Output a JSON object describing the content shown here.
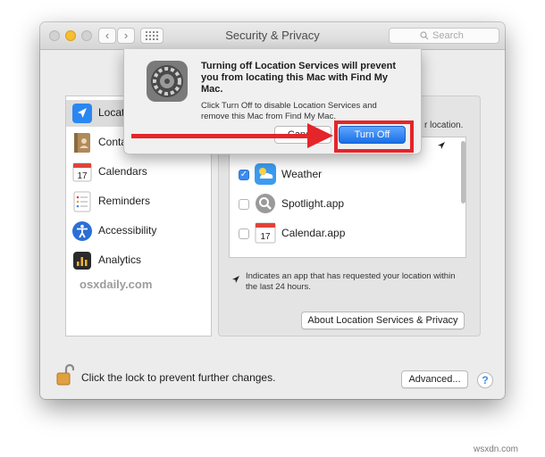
{
  "window": {
    "title": "Security & Privacy",
    "search_placeholder": "Search"
  },
  "sidebar": {
    "items": [
      {
        "label": "Location Services",
        "icon": "location-arrow-icon"
      },
      {
        "label": "Contacts",
        "icon": "contacts-book-icon"
      },
      {
        "label": "Calendars",
        "icon": "calendar-icon"
      },
      {
        "label": "Reminders",
        "icon": "reminders-list-icon"
      },
      {
        "label": "Accessibility",
        "icon": "accessibility-icon"
      },
      {
        "label": "Analytics",
        "icon": "analytics-icon"
      }
    ]
  },
  "watermark": "osxdaily.com",
  "panel": {
    "partial_text": "r location.",
    "apps": [
      {
        "label": "Weather",
        "checked": true,
        "icon": "weather-icon"
      },
      {
        "label": "Spotlight.app",
        "checked": false,
        "icon": "spotlight-icon"
      },
      {
        "label": "Calendar.app",
        "checked": false,
        "icon": "calendar-app-icon"
      }
    ],
    "hint": "Indicates an app that has requested your location within the last 24 hours.",
    "about_button": "About Location Services & Privacy"
  },
  "footer": {
    "lock_label": "Click the lock to prevent further changes.",
    "advanced_button": "Advanced...",
    "help_label": "?"
  },
  "dialog": {
    "title": "Turning off Location Services will prevent you from locating this Mac with Find My Mac.",
    "message": "Click Turn Off to disable Location Services and remove this Mac from Find My Mac.",
    "cancel_button": "Cancel",
    "confirm_button": "Turn Off"
  },
  "colors": {
    "accent": "#1a6fe6",
    "annotation": "#e4252a"
  },
  "site_mark": "wsxdn.com"
}
